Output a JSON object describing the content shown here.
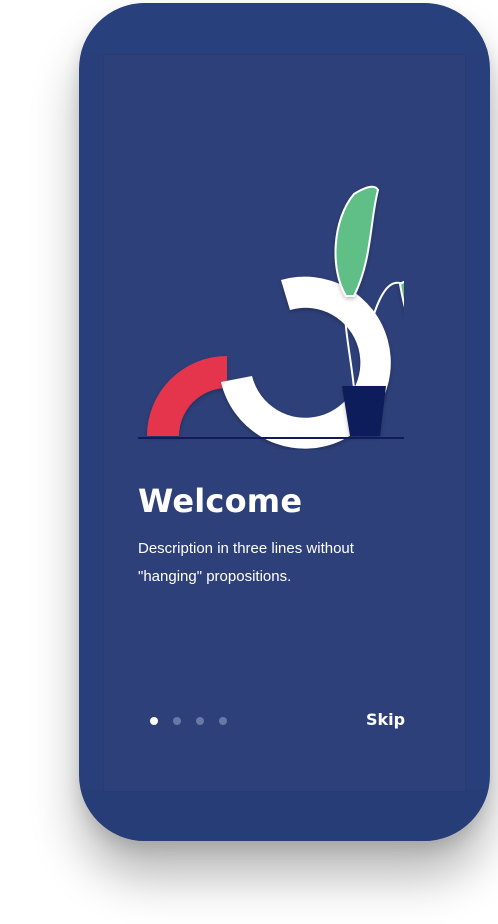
{
  "onboarding": {
    "title": "Welcome",
    "description": "Description in three lines without\n\"hanging\" propositions.",
    "skip_label": "Skip",
    "illustration": "plant-and-arches-illustration"
  },
  "pager": {
    "total": 4,
    "active_index": 0
  },
  "colors": {
    "phone_body": "#293f7c",
    "screen_background": "#2e4079",
    "accent_red": "#e5364d",
    "arch_white": "#ffffff",
    "leaf_green": "#5fbf86",
    "pot_navy": "#0f1b5a"
  }
}
